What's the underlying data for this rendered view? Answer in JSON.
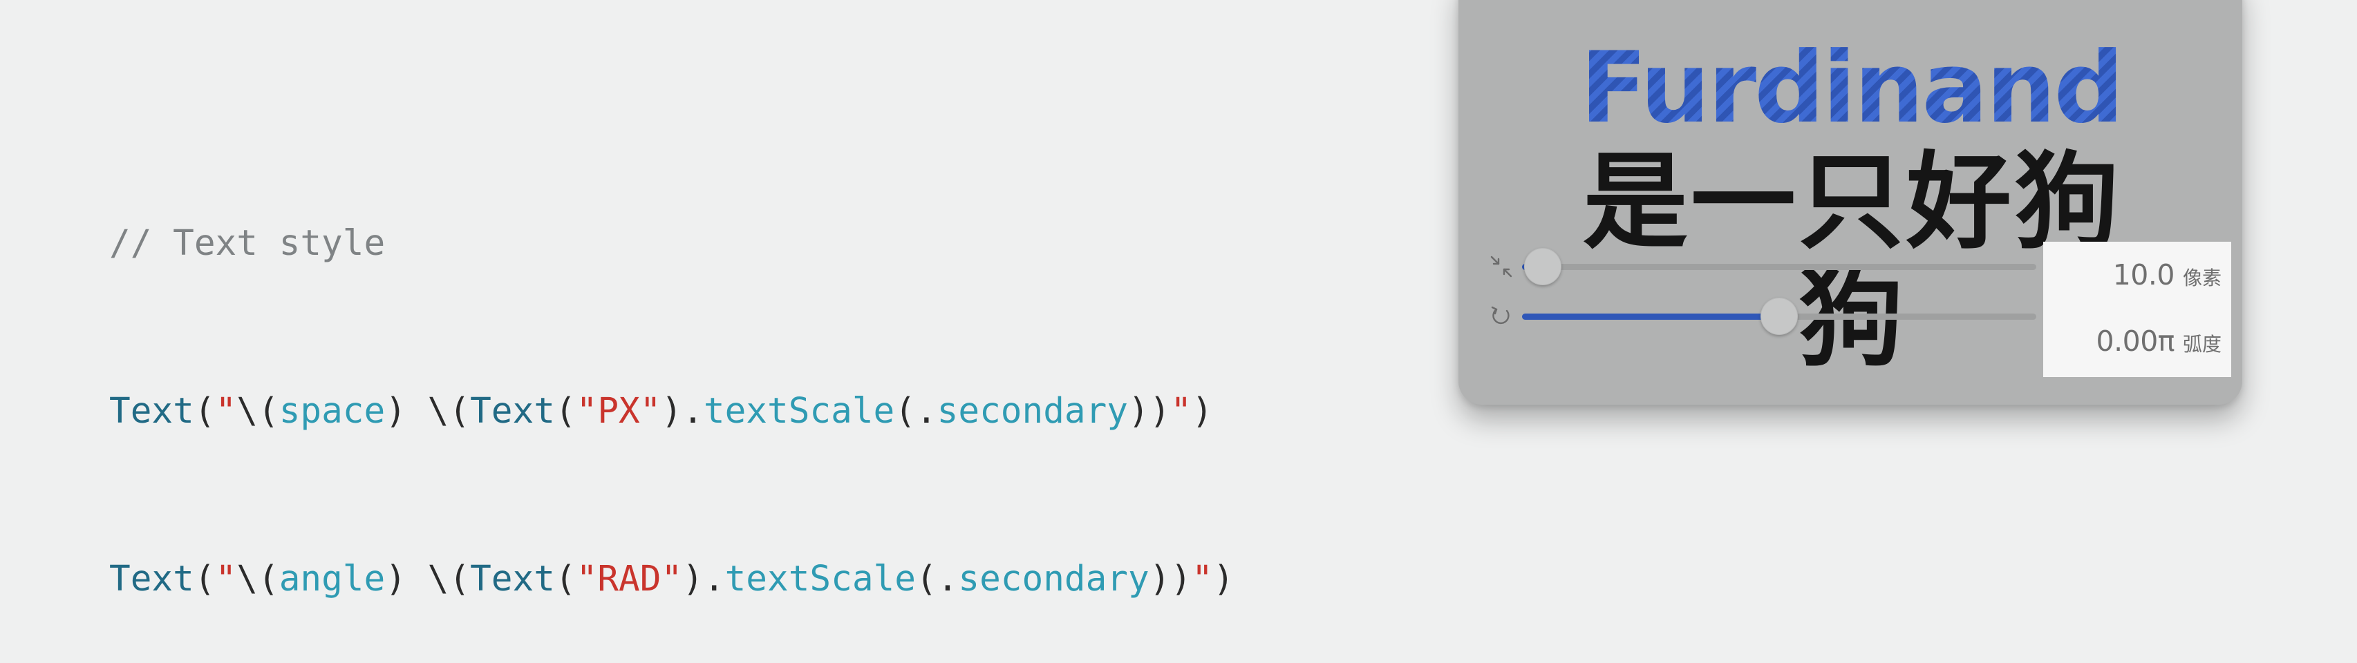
{
  "code": {
    "comment": "// Text style",
    "line1": {
      "type": "Text",
      "open_paren": "(",
      "quote_open": "\"",
      "interp_open": "\\(",
      "param": "space",
      "interp_close": ")",
      "space": " ",
      "interp_open2": "\\(",
      "inner_type": "Text",
      "inner_paren": "(",
      "string": "\"PX\"",
      "inner_close": ")",
      "dot": ".",
      "method": "textScale",
      "method_paren": "(",
      "arg_dot": ".",
      "arg": "secondary",
      "closes": "))",
      "quote_close": "\"",
      "final_close": ")"
    },
    "line2": {
      "type": "Text",
      "open_paren": "(",
      "quote_open": "\"",
      "interp_open": "\\(",
      "param": "angle",
      "interp_close": ")",
      "space": " ",
      "interp_open2": "\\(",
      "inner_type": "Text",
      "inner_paren": "(",
      "string": "\"RAD\"",
      "inner_close": ")",
      "dot": ".",
      "method": "textScale",
      "method_paren": "(",
      "arg_dot": ".",
      "arg": "secondary",
      "closes": "))",
      "quote_close": "\"",
      "final_close": ")"
    }
  },
  "preview": {
    "title_latin": "Furdinand",
    "title_cjk": "是一只好狗狗",
    "space_slider": {
      "icon": "compress-arrows-icon",
      "level": 0.04,
      "value": "10.0",
      "unit": "像素"
    },
    "angle_slider": {
      "icon": "rotate-icon",
      "level": 0.5,
      "value": "0.00π",
      "unit": "弧度"
    }
  },
  "colors": {
    "background": "#eff0f0",
    "accent": "#2f57b8",
    "window": "#b1b2b2",
    "code_type": "#216a85",
    "code_param": "#2f9bb3",
    "code_string": "#c9342c",
    "code_comment": "#7f8385"
  }
}
